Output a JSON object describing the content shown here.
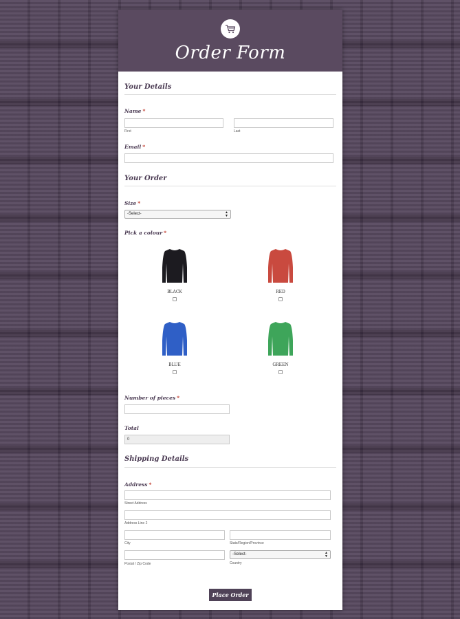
{
  "header": {
    "title": "Order Form",
    "cart_icon": "cart-icon"
  },
  "your_details": {
    "title": "Your Details",
    "name_label": "Name",
    "first_sub": "First",
    "last_sub": "Last",
    "email_label": "Email",
    "required_mark": "*"
  },
  "your_order": {
    "title": "Your Order",
    "size_label": "Size",
    "size_selected": "-Select-",
    "colour_label": "Pick a colour",
    "colours": [
      {
        "name": "BLACK",
        "color": "#1c1b20"
      },
      {
        "name": "RED",
        "color": "#c94a3f"
      },
      {
        "name": "BLUE",
        "color": "#2f5fc6"
      },
      {
        "name": "GREEN",
        "color": "#3ea55a"
      }
    ],
    "pieces_label": "Number of pieces",
    "total_label": "Total",
    "total_value": "0"
  },
  "shipping": {
    "title": "Shipping Details",
    "address_label": "Address",
    "street_sub": "Street Address",
    "line2_sub": "Address Line 2",
    "city_sub": "City",
    "state_sub": "State/Region/Province",
    "zip_sub": "Postal / Zip Code",
    "country_sub": "Country",
    "country_selected": "-Select-"
  },
  "submit": {
    "label": "Place Order"
  }
}
